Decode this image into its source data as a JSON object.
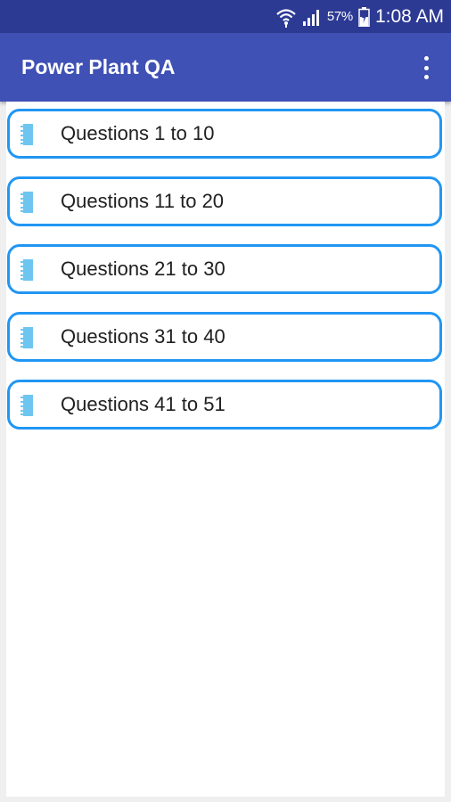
{
  "status_bar": {
    "battery_percent": "57%",
    "time": "1:08 AM",
    "icons": [
      "wifi-icon",
      "signal-icon",
      "battery-icon"
    ]
  },
  "app_bar": {
    "title": "Power Plant QA",
    "menu_icon": "more-vert-icon"
  },
  "list": {
    "items": [
      {
        "label": "Questions 1 to 10",
        "icon": "notepad-icon"
      },
      {
        "label": "Questions 11 to 20",
        "icon": "notepad-icon"
      },
      {
        "label": "Questions 21 to 30",
        "icon": "notepad-icon"
      },
      {
        "label": "Questions 31 to 40",
        "icon": "notepad-icon"
      },
      {
        "label": "Questions 41 to 51",
        "icon": "notepad-icon"
      }
    ]
  },
  "colors": {
    "status_bar": "#2c3a94",
    "app_bar": "#3f51b5",
    "item_border": "#2196f3",
    "icon": "#6ec6f0"
  }
}
